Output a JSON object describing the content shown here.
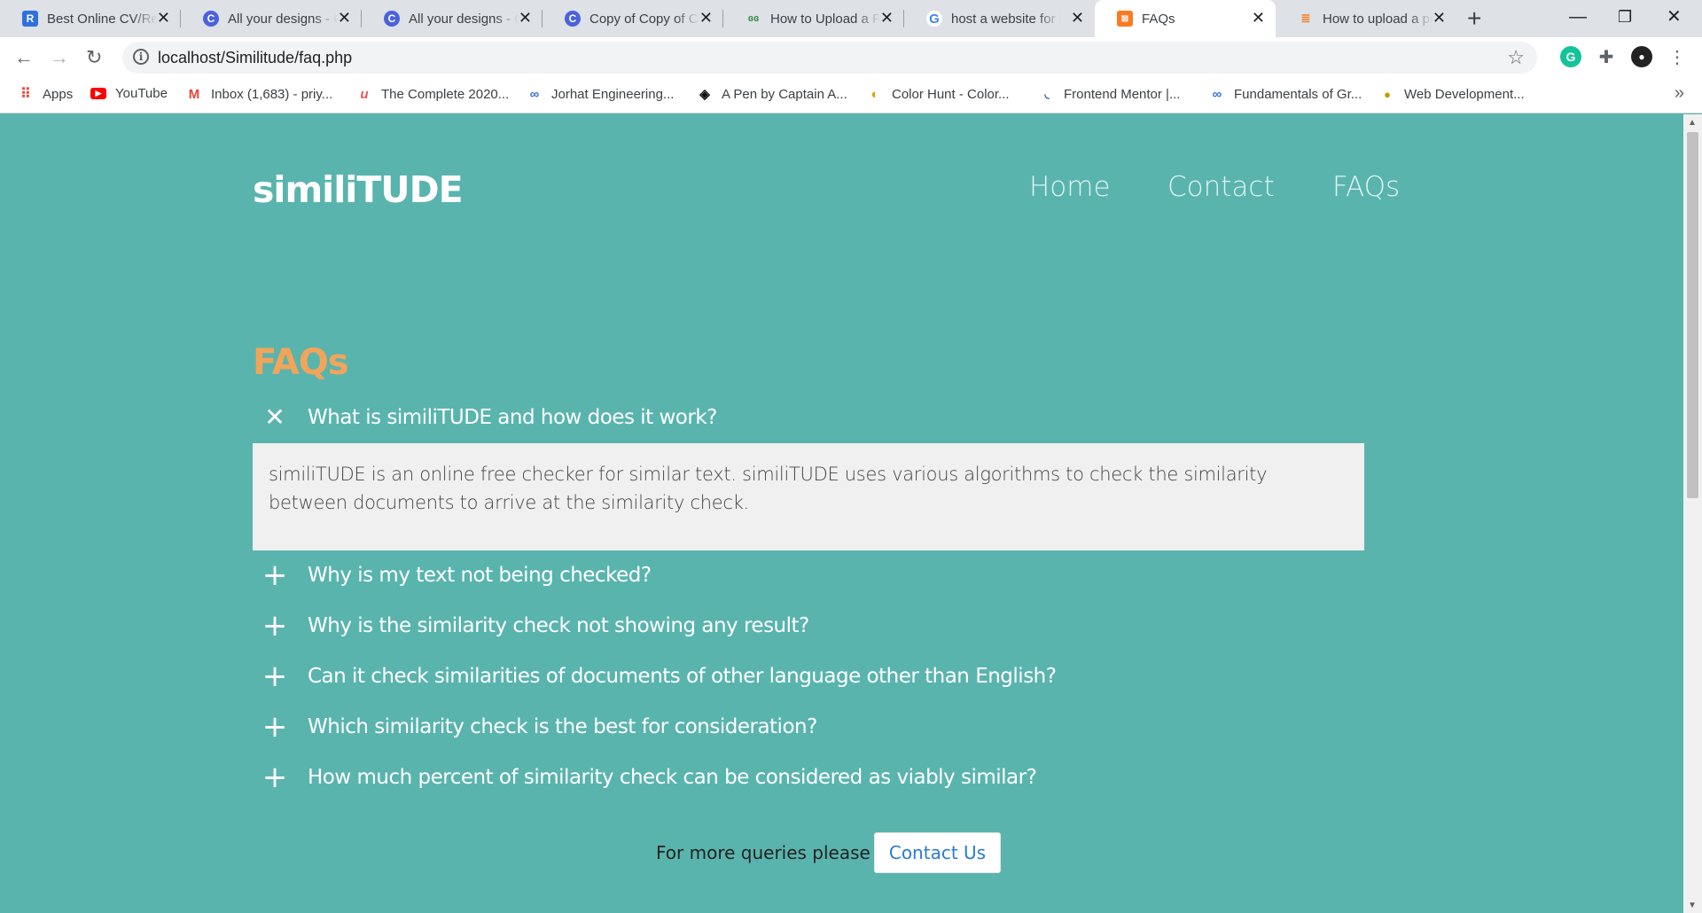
{
  "browser": {
    "tabs": [
      {
        "title": "Best Online CV/Resume",
        "favicon": "R",
        "favicon_color": "#2f6fdf"
      },
      {
        "title": "All your designs - Canva",
        "favicon": "C",
        "favicon_color": "#4a63dd"
      },
      {
        "title": "All your designs - Canva",
        "favicon": "C",
        "favicon_color": "#4a63dd"
      },
      {
        "title": "Copy of Copy of Canva",
        "favicon": "C",
        "favicon_color": "#4a63dd"
      },
      {
        "title": "How to Upload a File",
        "favicon": "gfg",
        "favicon_color": "#2f8d46"
      },
      {
        "title": "host a website for free",
        "favicon": "G",
        "favicon_color": "#4285f4"
      },
      {
        "title": "FAQs",
        "favicon": "xampp",
        "favicon_color": "#fb7a24"
      },
      {
        "title": "How to upload a project",
        "favicon": "so",
        "favicon_color": "#f48024"
      }
    ],
    "active_tab": 6,
    "url": "localhost/Similitude/faq.php",
    "bookmarks": [
      {
        "label": "Apps",
        "icon": "apps-grid-icon"
      },
      {
        "label": "YouTube",
        "icon": "youtube-icon"
      },
      {
        "label": "Inbox (1,683) - priy...",
        "icon": "gmail-icon"
      },
      {
        "label": "The Complete 2020...",
        "icon": "udemy-icon"
      },
      {
        "label": "Jorhat Engineering...",
        "icon": "link-icon"
      },
      {
        "label": "A Pen by Captain A...",
        "icon": "codepen-icon"
      },
      {
        "label": "Color Hunt - Color...",
        "icon": "colorhunt-icon"
      },
      {
        "label": "Frontend Mentor |...",
        "icon": "frontend-mentor-icon"
      },
      {
        "label": "Fundamentals of Gr...",
        "icon": "link-icon"
      },
      {
        "label": "Web Development...",
        "icon": "web-dev-icon"
      }
    ]
  },
  "site": {
    "logo": "similiTUDE",
    "nav": [
      "Home",
      "Contact",
      "FAQs"
    ],
    "page_title": "FAQs",
    "faqs": [
      {
        "question": "What is similiTUDE and how does it work?",
        "expanded": true,
        "answer": "similiTUDE is an online free checker for similar text. similiTUDE uses various algorithms to check the similarity between documents to arrive at the similarity check."
      },
      {
        "question": "Why is my text not being checked?",
        "expanded": false
      },
      {
        "question": "Why is the similarity check not showing any result?",
        "expanded": false
      },
      {
        "question": "Can it check similarities of documents of other language other than English?",
        "expanded": false
      },
      {
        "question": "Which similarity check is the best for consideration?",
        "expanded": false
      },
      {
        "question": "How much percent of similarity check can be considered as viably similar?",
        "expanded": false
      }
    ],
    "signs": {
      "collapse": "✕",
      "expand": "+"
    },
    "more_queries_text": "For more queries please",
    "contact_button": "Contact Us"
  },
  "colors": {
    "page_bg": "#5ab4ae",
    "title_accent": "#f2a45a",
    "answer_bg": "#f0f0f0",
    "button_text": "#2a7ad5"
  }
}
